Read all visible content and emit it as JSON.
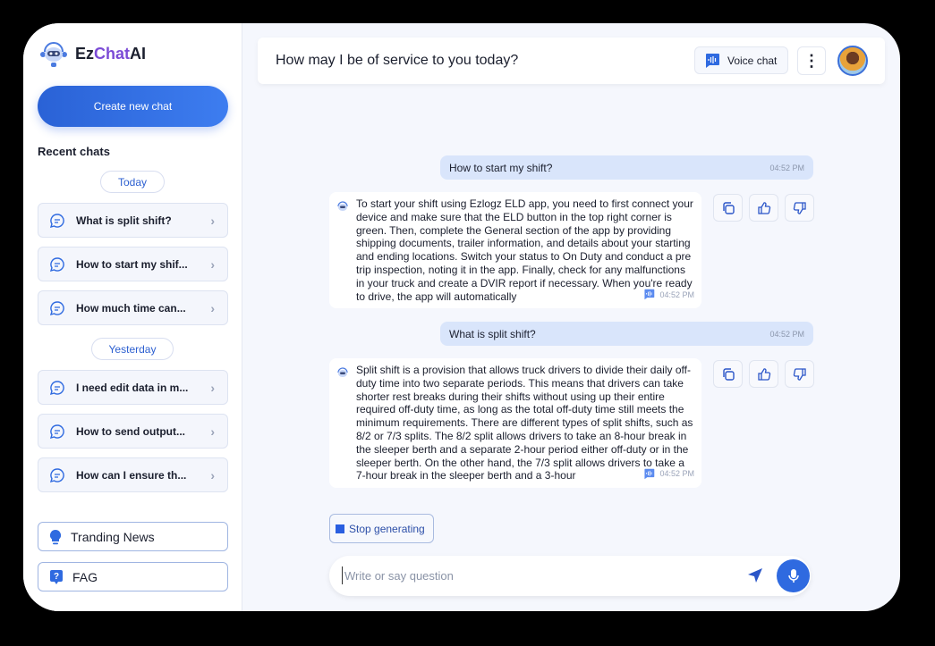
{
  "app": {
    "name_prefix": "Ez",
    "name_mid": "Chat",
    "name_suffix": "AI"
  },
  "sidebar": {
    "create_label": "Create new chat",
    "recent_label": "Recent chats",
    "groups": [
      {
        "label": "Today",
        "items": [
          "What is split shift?",
          "How to start my shif...",
          "How much time can..."
        ]
      },
      {
        "label": "Yesterday",
        "items": [
          "I need edit data in m...",
          "How to send output...",
          "How can I ensure th..."
        ]
      }
    ],
    "trending_label": "Tranding News",
    "faq_label": "FAG"
  },
  "header": {
    "title": "How may I be of service to you today?",
    "voice_label": "Voice chat"
  },
  "messages": [
    {
      "role": "user",
      "text": "How to start my shift?",
      "time": "04:52 PM"
    },
    {
      "role": "bot",
      "text": "To start your shift using Ezlogz ELD app, you need to first connect your device and make sure that the ELD button in the top right corner is green. Then, complete the General section of the app by providing shipping documents, trailer information, and details about your starting and ending locations. Switch your status to On Duty and conduct a pre trip inspection, noting it in the app. Finally, check for any malfunctions in your truck and create a DVIR report if necessary. When you're ready to drive, the app will automatically",
      "time": "04:52 PM"
    },
    {
      "role": "user",
      "text": "What is split shift?",
      "time": "04:52 PM"
    },
    {
      "role": "bot",
      "text": "Split shift is a provision that allows truck drivers to divide their daily off-duty time into two separate periods. This means that drivers can take shorter rest breaks during their shifts without using up their entire required off-duty time, as long as the total off-duty time still meets the minimum requirements. There are different types of split shifts, such as 8/2 or 7/3 splits. The 8/2 split allows drivers to take an 8-hour break in the sleeper berth and a separate 2-hour period either off-duty or in the sleeper berth. On the other hand, the 7/3 split allows drivers to take a 7-hour break in the sleeper berth and a 3-hour",
      "time": "04:52 PM"
    }
  ],
  "stop_label": "Stop generating",
  "input": {
    "placeholder": "Write or say question",
    "value": ""
  },
  "colors": {
    "accent": "#2f6ae0",
    "user_bubble": "#d9e5fb",
    "background": "#f5f7fd",
    "logo_purple": "#7b4bd6"
  }
}
